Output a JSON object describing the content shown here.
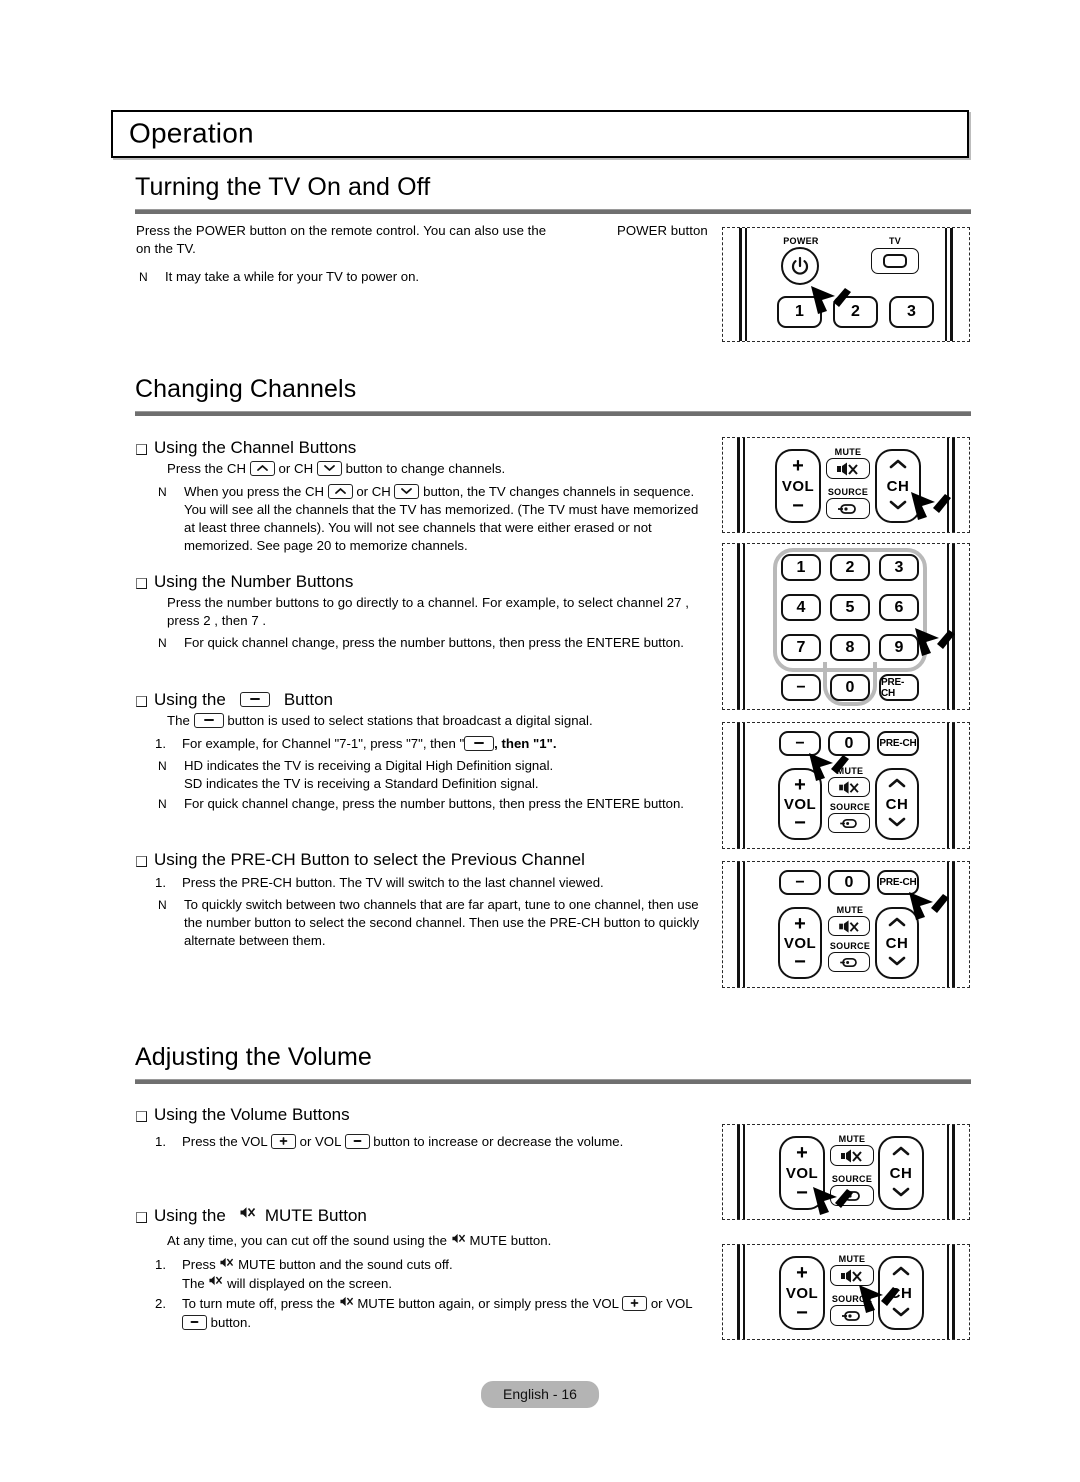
{
  "chapter": {
    "title": "Operation"
  },
  "sections": [
    {
      "id": "power",
      "title": "Turning the TV On and Off",
      "intro_a": "Press the  POWER button on the remote control. You can also use the",
      "intro_b": "POWER button",
      "intro_c": "on the TV.",
      "note_mark": "N",
      "note": "It may take a while for your TV to power on."
    },
    {
      "id": "channels",
      "title": "Changing Channels",
      "items": [
        {
          "heading": "Using the Channel Buttons",
          "lead_a": "Press the CH",
          "lead_b": "or CH",
          "lead_c": "button to change channels.",
          "note_mark": "N",
          "note_a": "When you press the CH",
          "note_b": "or CH",
          "note_c": "button, the TV changes channels in sequence. You will see all the channels that the TV has memorized. (The TV must have memorized at least three channels). You will not see channels that were either erased or not memorized. See page 20 to memorize channels."
        },
        {
          "heading": "Using the Number Buttons",
          "lead": "Press the number buttons to go directly to a channel. For example, to select channel  27 , press  2 , then  7 .",
          "note_mark": "N",
          "note": "For quick channel change, press the number buttons, then press the ENTERE button."
        },
        {
          "heading_a": "Using the",
          "heading_b": "Button",
          "lead_a": "The",
          "lead_b": "button is used to select stations that broadcast a digital signal.",
          "step_mark": "1.",
          "step_a": "For example, for Channel \"7-1\", press \"7\", then \"",
          "step_b": ", then \"1\".",
          "note1_mark": "N",
          "note1_line1": "HD indicates the TV is receiving a Digital High Definition signal.",
          "note1_line2": "SD indicates the TV is receiving a Standard Definition signal.",
          "note2_mark": "N",
          "note2": "For quick channel change, press the number buttons, then press the ENTERE button."
        },
        {
          "heading": "Using the PRE-CH Button to select the Previous Channel",
          "step_mark": "1.",
          "step": "Press the PRE-CH button. The TV will switch to the last channel viewed.",
          "note_mark": "N",
          "note": "To quickly switch between two channels that are far apart, tune to one channel, then use the number button to select the second channel. Then use the PRE-CH button to quickly alternate between them."
        }
      ]
    },
    {
      "id": "volume",
      "title": "Adjusting the Volume",
      "items": [
        {
          "heading": "Using the Volume Buttons",
          "step_mark": "1.",
          "step_a": "Press the VOL",
          "step_b": "or VOL",
          "step_c": "button to increase or decrease the volume."
        },
        {
          "heading_a": "Using the",
          "heading_b": "MUTE Button",
          "lead_a": "At any time, you can cut off the sound using the",
          "lead_b": "MUTE button.",
          "step1_mark": "1.",
          "step1_a": "Press",
          "step1_b": "MUTE button and the sound cuts off.",
          "step1_c": "The",
          "step1_d": "will displayed on the screen.",
          "step2_mark": "2.",
          "step2_a": "To turn mute off, press the",
          "step2_b": "MUTE button again, or simply press the VOL",
          "step2_c": "or VOL",
          "step2_d": "button."
        }
      ]
    }
  ],
  "remotes": [
    {
      "id": "power-remote",
      "labels": {
        "power": "POWER",
        "tv": "TV",
        "k1": "1",
        "k2": "2",
        "k3": "3"
      },
      "pointer": "power-button"
    },
    {
      "id": "ch-remote",
      "labels": {
        "vol": "VOL",
        "ch": "CH",
        "mute": "MUTE",
        "source": "SOURCE",
        "plus": "+",
        "minus": "−"
      },
      "pointer": "ch-button"
    },
    {
      "id": "numpad-remote",
      "labels": {
        "keys": [
          "1",
          "2",
          "3",
          "4",
          "5",
          "6",
          "7",
          "8",
          "9"
        ],
        "dash": "−",
        "zero": "0",
        "prech": "PRE-CH"
      },
      "pointer": "number-keys"
    },
    {
      "id": "dash-remote",
      "labels": {
        "dash": "−",
        "zero": "0",
        "prech": "PRE-CH",
        "vol": "VOL",
        "ch": "CH",
        "mute": "MUTE",
        "source": "SOURCE"
      },
      "pointer": "dash-button"
    },
    {
      "id": "prech-remote",
      "labels": {
        "dash": "−",
        "zero": "0",
        "prech": "PRE-CH",
        "vol": "VOL",
        "ch": "CH",
        "mute": "MUTE",
        "source": "SOURCE"
      },
      "pointer": "prech-button"
    },
    {
      "id": "vol-remote",
      "labels": {
        "vol": "VOL",
        "ch": "CH",
        "mute": "MUTE",
        "source": "SOURCE"
      },
      "pointer": "vol-button"
    },
    {
      "id": "mute-remote",
      "labels": {
        "vol": "VOL",
        "ch": "CH",
        "mute": "MUTE",
        "source": "SOURCE"
      },
      "pointer": "mute-button"
    }
  ],
  "footer": {
    "label": "English - 16"
  }
}
